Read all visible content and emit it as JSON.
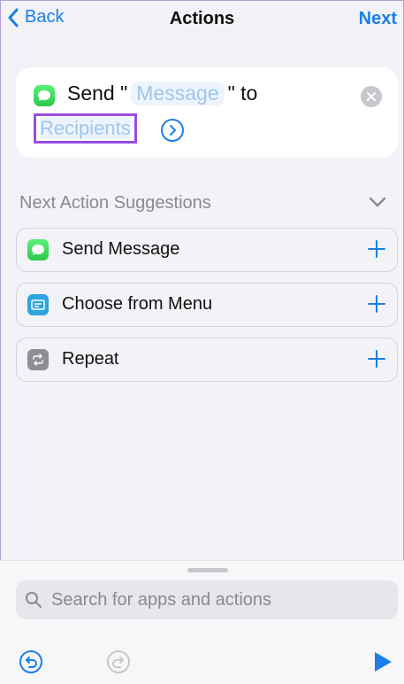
{
  "nav": {
    "back_label": "Back",
    "title": "Actions",
    "next_label": "Next"
  },
  "action": {
    "send_prefix": "Send \"",
    "message_token": "Message",
    "to_text": "\" to",
    "recipients_token": "Recipients"
  },
  "suggestions": {
    "header": "Next Action Suggestions",
    "items": [
      {
        "label": "Send Message"
      },
      {
        "label": "Choose from Menu"
      },
      {
        "label": "Repeat"
      }
    ]
  },
  "search": {
    "placeholder": "Search for apps and actions"
  },
  "colors": {
    "accent": "#1a7fe8",
    "highlight_border": "#9a4de0"
  }
}
